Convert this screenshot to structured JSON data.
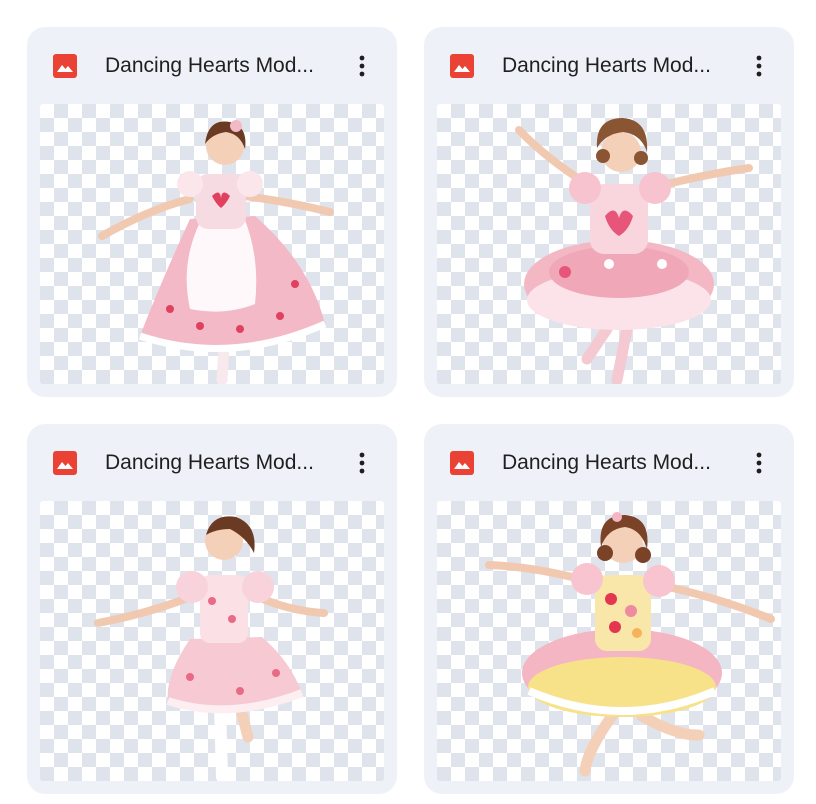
{
  "files": [
    {
      "name": "Dancing Hearts Mod...",
      "icon": "image-file-icon",
      "dress_color": "#f3b9c6",
      "bodice_color": "#f7dbe2",
      "apron_color": "#ffffff",
      "accent": "#e0415e"
    },
    {
      "name": "Dancing Hearts Mod...",
      "icon": "image-file-icon",
      "dress_color": "#f4b7c4",
      "bodice_color": "#f9d6de",
      "apron_color": "#fbe3e9",
      "accent": "#e8557a"
    },
    {
      "name": "Dancing Hearts Mod...",
      "icon": "image-file-icon",
      "dress_color": "#f6c9d3",
      "bodice_color": "#fbe0e6",
      "apron_color": "#fdeef1",
      "accent": "#e86a86"
    },
    {
      "name": "Dancing Hearts Mod...",
      "icon": "image-file-icon",
      "dress_color": "#f7e28a",
      "bodice_color": "#f8e7a8",
      "apron_color": "#f4b6c2",
      "accent": "#e3374f"
    }
  ],
  "colors": {
    "card_bg": "#eef1f7",
    "icon_red": "#ea4335",
    "text": "#1f1f1f"
  }
}
